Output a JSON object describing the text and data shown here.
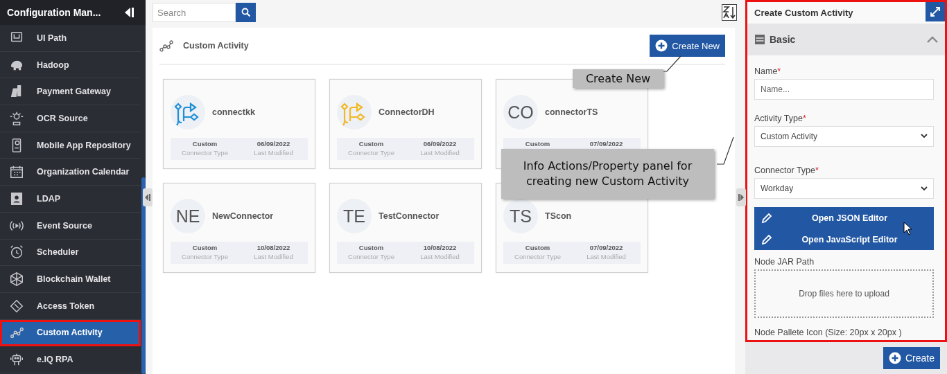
{
  "sidebar": {
    "title": "Configuration Man...",
    "items": [
      {
        "label": "UI Path",
        "selected": false
      },
      {
        "label": "Hadoop",
        "selected": false
      },
      {
        "label": "Payment Gateway",
        "selected": false
      },
      {
        "label": "OCR Source",
        "selected": false
      },
      {
        "label": "Mobile App Repository",
        "selected": false
      },
      {
        "label": "Organization Calendar",
        "selected": false
      },
      {
        "label": "LDAP",
        "selected": false
      },
      {
        "label": "Event Source",
        "selected": false
      },
      {
        "label": "Scheduler",
        "selected": false
      },
      {
        "label": "Blockchain Wallet",
        "selected": false
      },
      {
        "label": "Access Token",
        "selected": false
      },
      {
        "label": "Custom Activity",
        "selected": true
      },
      {
        "label": "e.IQ RPA",
        "selected": false
      }
    ]
  },
  "search": {
    "placeholder": "Search"
  },
  "content": {
    "title": "Custom Activity",
    "create_button": "Create New",
    "cards": [
      {
        "name": "connectkk",
        "icon": {
          "kind": "connector",
          "color": "#1f8fd6"
        },
        "type": "Custom",
        "type_label": "Connector Type",
        "date": "06/09/2022",
        "date_label": "Last Modified"
      },
      {
        "name": "ConnectorDH",
        "icon": {
          "kind": "connector",
          "color": "#f2b824"
        },
        "type": "Custom",
        "type_label": "Connector Type",
        "date": "06/09/2022",
        "date_label": "Last Modified"
      },
      {
        "name": "connectorTS",
        "icon": {
          "kind": "initials",
          "text": "CO"
        },
        "type": "Custom",
        "date": "07/09/2022"
      },
      {
        "name": "NewConnector",
        "icon": {
          "kind": "initials",
          "text": "NE"
        },
        "type": "Custom",
        "type_label": "Connector Type",
        "date": "10/08/2022",
        "date_label": "Last Modified"
      },
      {
        "name": "TestConnector",
        "icon": {
          "kind": "initials",
          "text": "TE"
        },
        "type": "Custom",
        "type_label": "Connector Type",
        "date": "10/08/2022",
        "date_label": "Last Modified"
      },
      {
        "name": "TScon",
        "icon": {
          "kind": "initials",
          "text": "TS"
        },
        "type": "Custom",
        "type_label": "Connector Type",
        "date": "07/09/2022",
        "date_label": "Last Modified"
      }
    ]
  },
  "panel": {
    "title": "Create Custom Activity",
    "highlighted": true,
    "section": {
      "title": "Basic",
      "expanded": true
    },
    "fields": [
      {
        "kind": "text",
        "label": "Name",
        "marker": "*",
        "placeholder": "Name..."
      },
      {
        "kind": "select",
        "label": "Activity Type",
        "marker": "*",
        "value": "Custom Activity"
      },
      {
        "kind": "select",
        "label": "Connector Type",
        "marker": "*",
        "value": "Workday"
      }
    ],
    "editor_buttons": [
      "Open JSON Editor",
      "Open JavaScript Editor"
    ],
    "upload": {
      "label": "Node JAR Path",
      "hint": "Drop files here to upload"
    },
    "icon_label": "Node Pallete Icon (Size: 20px x 20px )",
    "create_button": "Create"
  },
  "callouts": [
    {
      "text": "Create New"
    },
    {
      "text": "Info Actions/Property panel for creating new Custom Activity"
    }
  ]
}
